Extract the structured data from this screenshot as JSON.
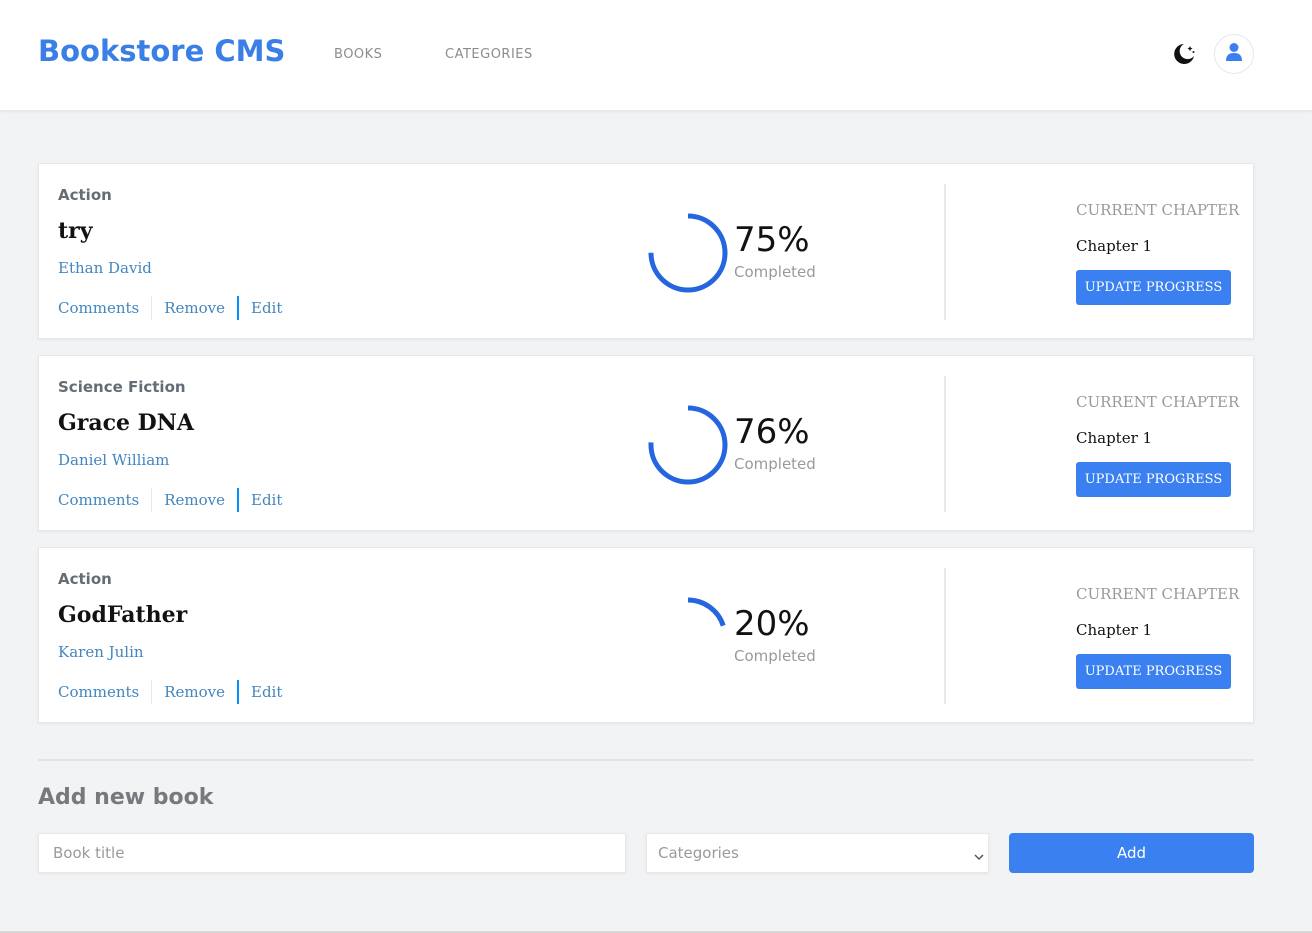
{
  "header": {
    "brand": "Bookstore CMS",
    "nav": [
      "BOOKS",
      "CATEGORIES"
    ],
    "theme_icon": "moon-stars-icon",
    "avatar_icon": "user-icon"
  },
  "colors": {
    "accent": "#3a7fe6",
    "button": "#3a80f1",
    "progress": "#2665e0",
    "link": "#4386bf"
  },
  "books": [
    {
      "genre": "Action",
      "title": "try",
      "author": "Ethan David",
      "actions": [
        "Comments",
        "Remove",
        "Edit"
      ],
      "percent": "75%",
      "progress": 0.75,
      "completed_label": "Completed",
      "current_chapter_label": "CURRENT CHAPTER",
      "chapter": "Chapter 1",
      "update_label": "UPDATE PROGRESS"
    },
    {
      "genre": "Science Fiction",
      "title": "Grace DNA",
      "author": "Daniel William",
      "actions": [
        "Comments",
        "Remove",
        "Edit"
      ],
      "percent": "76%",
      "progress": 0.76,
      "completed_label": "Completed",
      "current_chapter_label": "CURRENT CHAPTER",
      "chapter": "Chapter 1",
      "update_label": "UPDATE PROGRESS"
    },
    {
      "genre": "Action",
      "title": "GodFather",
      "author": "Karen Julin",
      "actions": [
        "Comments",
        "Remove",
        "Edit"
      ],
      "percent": "20%",
      "progress": 0.2,
      "completed_label": "Completed",
      "current_chapter_label": "CURRENT CHAPTER",
      "chapter": "Chapter 1",
      "update_label": "UPDATE PROGRESS"
    }
  ],
  "add_form": {
    "heading": "Add new book",
    "title_placeholder": "Book title",
    "category_placeholder": "Categories",
    "add_label": "Add"
  }
}
